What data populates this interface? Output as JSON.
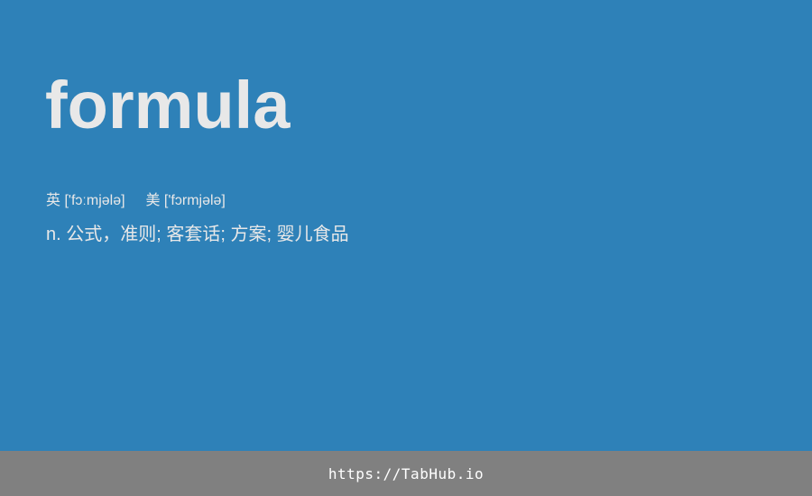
{
  "entry": {
    "word": "formula",
    "phonetics": {
      "uk_label": "英",
      "uk_ipa": "['fɔːmjələ]",
      "us_label": "美",
      "us_ipa": "['fɔrmjələ]"
    },
    "definition": "n. 公式，准则; 客套话; 方案; 婴儿食品"
  },
  "footer": {
    "link_text": "https://TabHub.io"
  },
  "colors": {
    "background": "#2e81b8",
    "text": "#e8e8e8",
    "footer_bg": "#808080",
    "footer_text": "#ffffff"
  }
}
